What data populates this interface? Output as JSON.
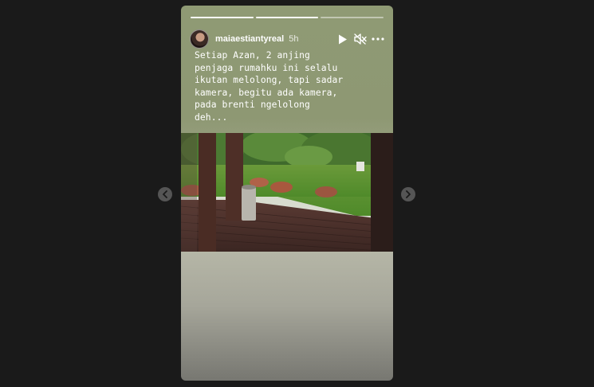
{
  "story": {
    "username": "maiaestiantyreal",
    "time": "5h",
    "caption": "Setiap Azan, 2 anjing\npenjaga rumahku ini selalu\nikutan melolong, tapi sadar\nkamera, begitu ada kamera,\npada brenti ngelolong\ndeh...",
    "progress": [
      1.0,
      1.0,
      0.0
    ]
  },
  "icons": {
    "play": "play-icon",
    "mute": "speaker-muted-icon",
    "more": "more-icon",
    "prev": "chevron-left-icon",
    "next": "chevron-right-icon"
  },
  "colors": {
    "page_bg": "#1a1a1a",
    "story_bg": "#8f9a74",
    "text": "#ffffff"
  }
}
